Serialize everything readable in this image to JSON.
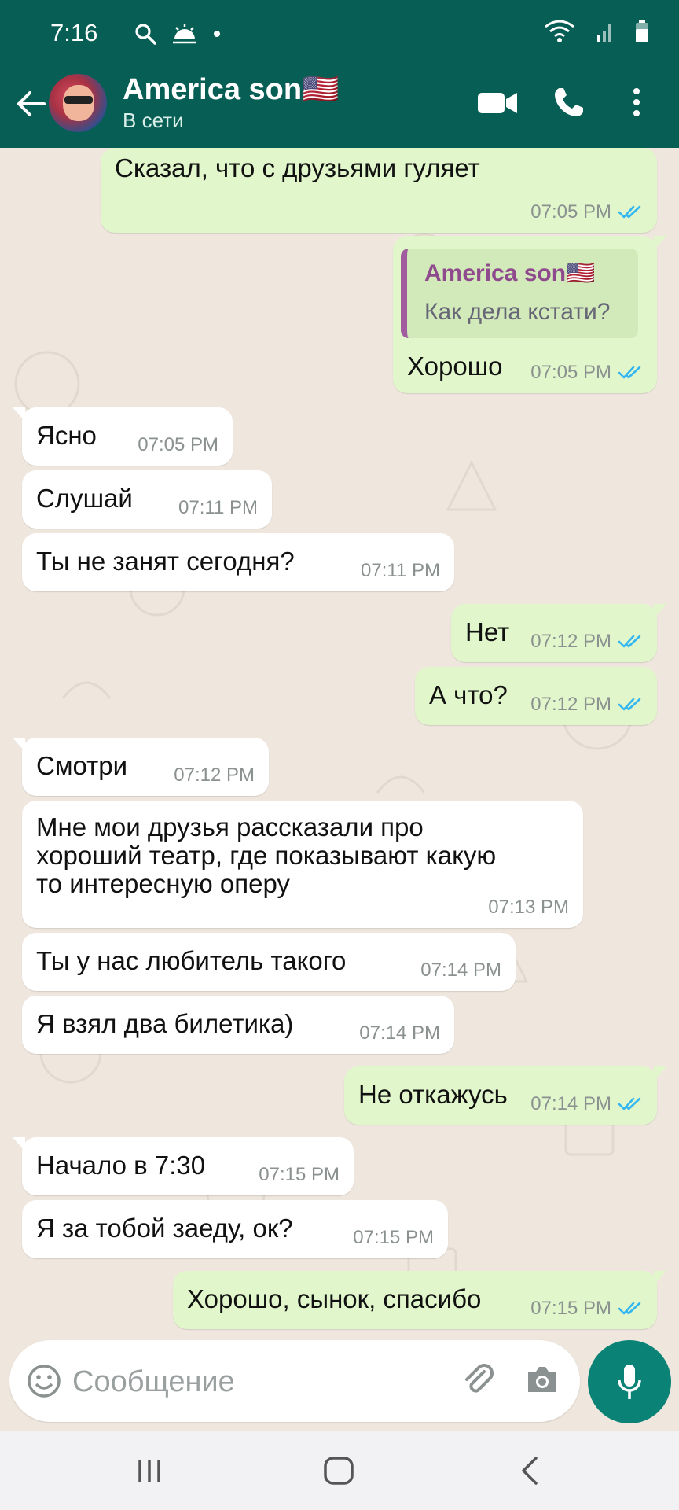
{
  "status_bar": {
    "time": "7:16"
  },
  "header": {
    "contact_name": "America son🇺🇸",
    "contact_status": "В сети"
  },
  "messages": [
    {
      "dir": "out",
      "text": "Сказал, что с друзьями гуляет",
      "time": "07:05 PM"
    },
    {
      "dir": "out",
      "quote_author": "America son🇺🇸",
      "quote_text": "Как дела кстати?",
      "text": "Хорошо",
      "time": "07:05 PM"
    },
    {
      "dir": "in",
      "text": "Ясно",
      "time": "07:05 PM"
    },
    {
      "dir": "in",
      "text": "Слушай",
      "time": "07:11 PM"
    },
    {
      "dir": "in",
      "text": "Ты не занят сегодня?",
      "time": "07:11 PM"
    },
    {
      "dir": "out",
      "text": "Нет",
      "time": "07:12 PM"
    },
    {
      "dir": "out",
      "text": "А что?",
      "time": "07:12 PM"
    },
    {
      "dir": "in",
      "text": "Смотри",
      "time": "07:12 PM"
    },
    {
      "dir": "in",
      "lines": [
        "Мне мои друзья рассказали про",
        "хороший театр, где показывают какую",
        "то интересную оперу"
      ],
      "time": "07:13 PM"
    },
    {
      "dir": "in",
      "text": "Ты у нас любитель такого",
      "time": "07:14 PM"
    },
    {
      "dir": "in",
      "text": "Я взял два билетика)",
      "time": "07:14 PM"
    },
    {
      "dir": "out",
      "text": "Не откажусь",
      "time": "07:14 PM"
    },
    {
      "dir": "in",
      "text": "Начало в 7:30",
      "time": "07:15 PM"
    },
    {
      "dir": "in",
      "text": "Я за тобой заеду, ок?",
      "time": "07:15 PM"
    },
    {
      "dir": "out",
      "text": "Хорошо, сынок, спасибо",
      "time": "07:15 PM"
    }
  ],
  "input": {
    "placeholder": "Сообщение"
  },
  "colors": {
    "header": "#075e54",
    "outgoing": "#e1f7cb",
    "incoming": "#ffffff",
    "read_ticks": "#34b7f1",
    "mic": "#0a8276"
  },
  "icons": [
    "back-arrow",
    "video-camera",
    "phone",
    "more-vert",
    "emoji",
    "paperclip",
    "camera",
    "microphone",
    "recents",
    "home",
    "back"
  ]
}
